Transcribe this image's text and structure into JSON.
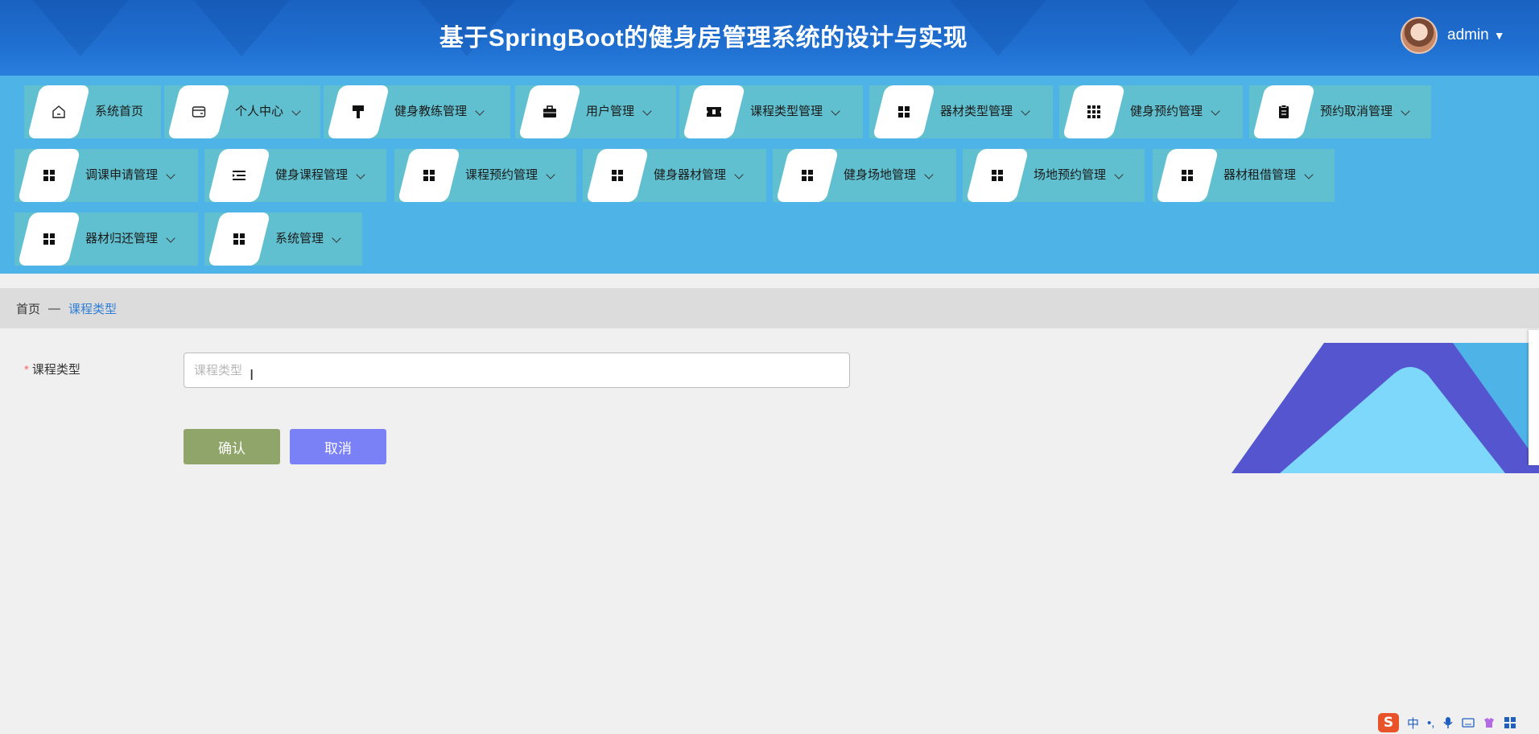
{
  "header": {
    "title": "基于SpringBoot的健身房管理系统的设计与实现",
    "username": "admin"
  },
  "menu": [
    {
      "label": "系统首页",
      "icon": "home-icon"
    },
    {
      "label": "个人中心",
      "icon": "wallet-icon"
    },
    {
      "label": "健身教练管理",
      "icon": "paint-roller-icon"
    },
    {
      "label": "用户管理",
      "icon": "briefcase-icon"
    },
    {
      "label": "课程类型管理",
      "icon": "ticket-icon"
    },
    {
      "label": "器材类型管理",
      "icon": "grid-icon"
    },
    {
      "label": "健身预约管理",
      "icon": "apps-icon"
    },
    {
      "label": "预约取消管理",
      "icon": "clipboard-icon"
    },
    {
      "label": "调课申请管理",
      "icon": "grid-icon"
    },
    {
      "label": "健身课程管理",
      "icon": "list-indent-icon"
    },
    {
      "label": "课程预约管理",
      "icon": "grid-icon"
    },
    {
      "label": "健身器材管理",
      "icon": "grid-icon"
    },
    {
      "label": "健身场地管理",
      "icon": "grid-icon"
    },
    {
      "label": "场地预约管理",
      "icon": "grid-icon"
    },
    {
      "label": "器材租借管理",
      "icon": "grid-icon"
    },
    {
      "label": "器材归还管理",
      "icon": "grid-icon"
    },
    {
      "label": "系统管理",
      "icon": "grid-icon"
    }
  ],
  "breadcrumb": {
    "home": "首页",
    "separator": "—",
    "current": "课程类型"
  },
  "form": {
    "required_mark": "*",
    "label": "课程类型",
    "placeholder": "课程类型",
    "value": "",
    "confirm_label": "确认",
    "cancel_label": "取消"
  },
  "tray": {
    "ime_logo": "S",
    "ime_lang": "中",
    "punct": "•,"
  },
  "colors": {
    "header": "#1f6fd0",
    "menu_band": "#4eb3e6",
    "menu_item": "#61c0cf",
    "confirm_button": "#8fa56a",
    "cancel_button": "#7a80f6",
    "breadcrumb_link": "#2f7fd6"
  }
}
